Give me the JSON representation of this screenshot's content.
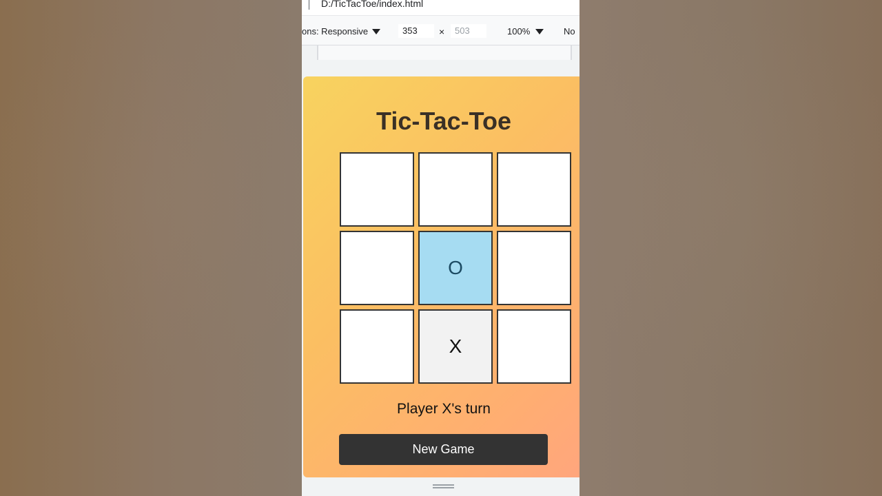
{
  "browser": {
    "address": "D:/TicTacToe/index.html"
  },
  "devtools": {
    "dimensions_label": "ons: Responsive",
    "width_value": "353",
    "height_value": "503",
    "times_symbol": "×",
    "zoom": "100%",
    "throttle_label": "No"
  },
  "game": {
    "title": "Tic-Tac-Toe",
    "board": [
      "",
      "",
      "",
      "",
      "O",
      "",
      "",
      "X",
      ""
    ],
    "status": "Player X's turn",
    "new_game_label": "New Game"
  },
  "colors": {
    "gradient_start": "#f8d35f",
    "gradient_end": "#ffa57e",
    "o_cell": "#a6dcf2",
    "x_cell": "#f2f2f2",
    "button": "#333333"
  },
  "icons": {
    "dimensions_dropdown": "caret-down-icon",
    "zoom_dropdown": "caret-down-icon",
    "resize": "drag-handle-icon"
  }
}
